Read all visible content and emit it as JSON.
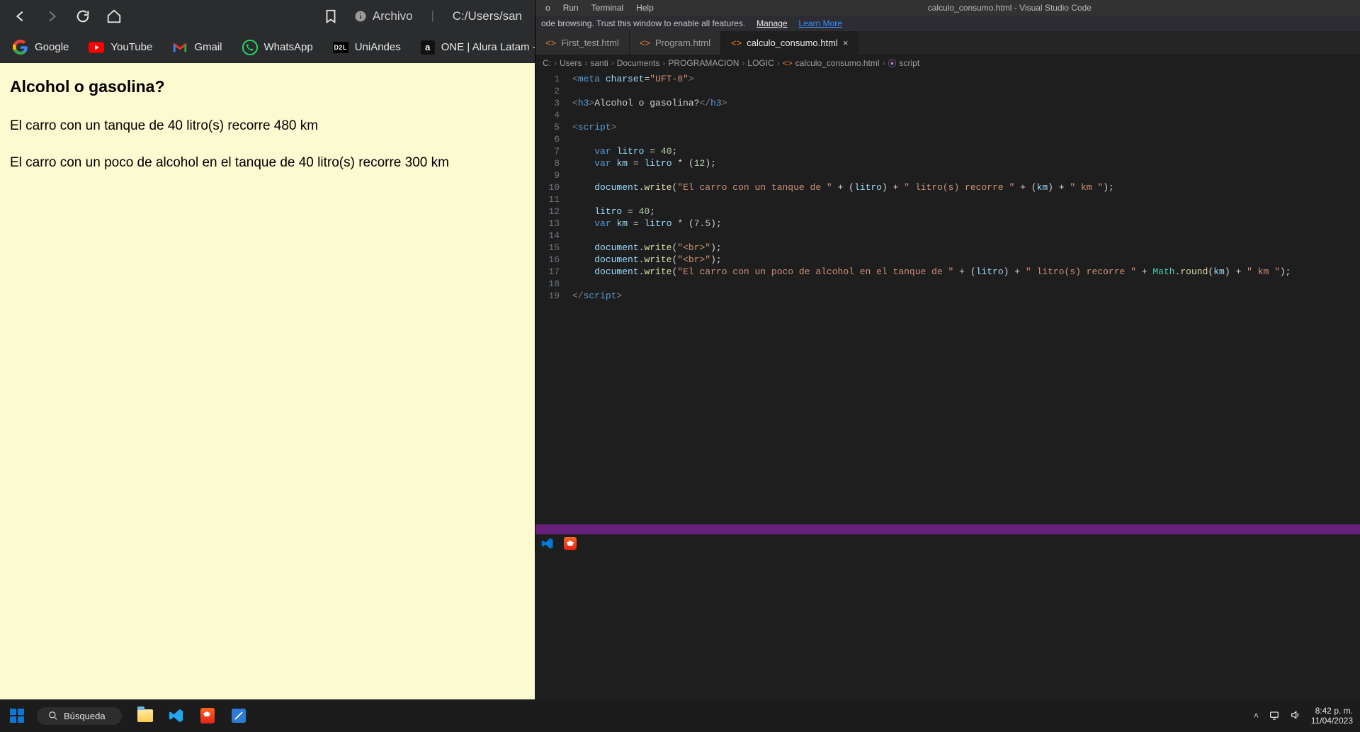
{
  "browser": {
    "toolbar": {
      "archivo_label": "Archivo",
      "url": "C:/Users/san"
    },
    "bookmarks": [
      {
        "label": "Google"
      },
      {
        "label": "YouTube"
      },
      {
        "label": "Gmail"
      },
      {
        "label": "WhatsApp"
      },
      {
        "label": "UniAndes"
      },
      {
        "label": "ONE | Alura Latam -..."
      }
    ],
    "page": {
      "heading": "Alcohol o gasolina?",
      "line1": "El carro con un tanque de 40 litro(s) recorre 480 km",
      "line2": "El carro con un poco de alcohol en el tanque de 40 litro(s) recorre 300 km"
    }
  },
  "vscode": {
    "title": "calculo_consumo.html - Visual Studio Code",
    "menus": [
      "o",
      "Run",
      "Terminal",
      "Help"
    ],
    "info_text": "ode browsing. Trust this window to enable all features.",
    "info_links": {
      "manage": "Manage",
      "learn": "Learn More"
    },
    "tabs": [
      {
        "label": "First_test.html",
        "active": false
      },
      {
        "label": "Program.html",
        "active": false
      },
      {
        "label": "calculo_consumo.html",
        "active": true
      }
    ],
    "breadcrumbs": [
      "C:",
      "Users",
      "santi",
      "Documents",
      "PROGRAMACION",
      "LOGIC",
      "calculo_consumo.html",
      "script"
    ],
    "code_lines": 19,
    "code": {
      "l1": {
        "charset": "UFT-8"
      },
      "l3": {
        "text": "Alcohol o gasolina?"
      },
      "l7": {
        "var": "litro",
        "val": "40"
      },
      "l8": {
        "var": "km",
        "expr_a": "litro",
        "expr_b": "12"
      },
      "l10": {
        "s1": "El carro con un tanque de ",
        "v1": "litro",
        "s2": " litro(s) recorre ",
        "v2": "km",
        "s3": " km "
      },
      "l12": {
        "var": "litro",
        "val": "40"
      },
      "l13": {
        "var": "km",
        "expr_a": "litro",
        "expr_b": "7.5"
      },
      "l15": {
        "arg": "<br>"
      },
      "l16": {
        "arg": "<br>"
      },
      "l17": {
        "s1": "El carro con un poco de alcohol en el tanque de ",
        "v1": "litro",
        "s2": " litro(s) recorre ",
        "v2": "km",
        "s3": " km "
      }
    }
  },
  "taskbar": {
    "search_placeholder": "Búsqueda",
    "time": "8:42 p. m.",
    "date": "11/04/2023"
  }
}
